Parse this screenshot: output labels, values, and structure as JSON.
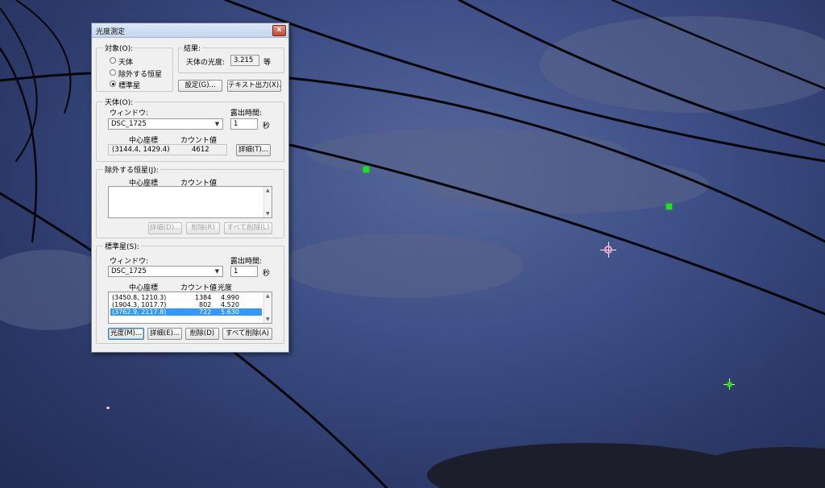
{
  "window": {
    "title": "光度測定",
    "close_glyph": "x"
  },
  "target_group": {
    "label": "対象(O):",
    "options": [
      "天体",
      "除外する恒星",
      "標準星"
    ],
    "selected_index": 2
  },
  "result_group": {
    "label": "結果:",
    "magnitude_label": "天体の光度:",
    "magnitude_value": "3.215",
    "unit": "等"
  },
  "top_buttons": {
    "settings": "設定(G)...",
    "text_output": "テキスト出力(X)..."
  },
  "object_group": {
    "label": "天体(O):",
    "window_label": "ウィンドウ:",
    "window_value": "DSC_1725",
    "exposure_label": "露出時間:",
    "exposure_value": "1",
    "exposure_unit": "秒",
    "col_center": "中心座標",
    "col_count": "カウント値",
    "center_value": "(3144.4, 1429.4)",
    "count_value": "4612",
    "detail_button": "詳細(T)..."
  },
  "exclude_group": {
    "label": "除外する恒星(J):",
    "col_center": "中心座標",
    "col_count": "カウント値",
    "detail_button": "詳細(D)...",
    "delete_button": "削除(R)",
    "delete_all_button": "すべて削除(L)"
  },
  "standard_group": {
    "label": "標準星(S):",
    "window_label": "ウィンドウ:",
    "window_value": "DSC_1725",
    "exposure_label": "露出時間:",
    "exposure_value": "1",
    "exposure_unit": "秒",
    "col_center": "中心座標",
    "col_count": "カウント値",
    "col_mag": "光度",
    "rows": [
      {
        "center": "(3450.8, 1210.3)",
        "count": "1384",
        "mag": "4.990"
      },
      {
        "center": "(1904.3, 1017.7)",
        "count": "802",
        "mag": "4.520"
      },
      {
        "center": "(3762.9, 2117.8)",
        "count": "722",
        "mag": "5.630"
      }
    ],
    "selected_row": 2,
    "photometry_button": "光度(M)...",
    "detail_button": "詳細(E)...",
    "delete_button": "削除(D)",
    "delete_all_button": "すべて削除(A)"
  },
  "colors": {
    "star_marker": "#1fe21f",
    "target_ring": "#ff9ce4",
    "selection": "#3399ff"
  }
}
